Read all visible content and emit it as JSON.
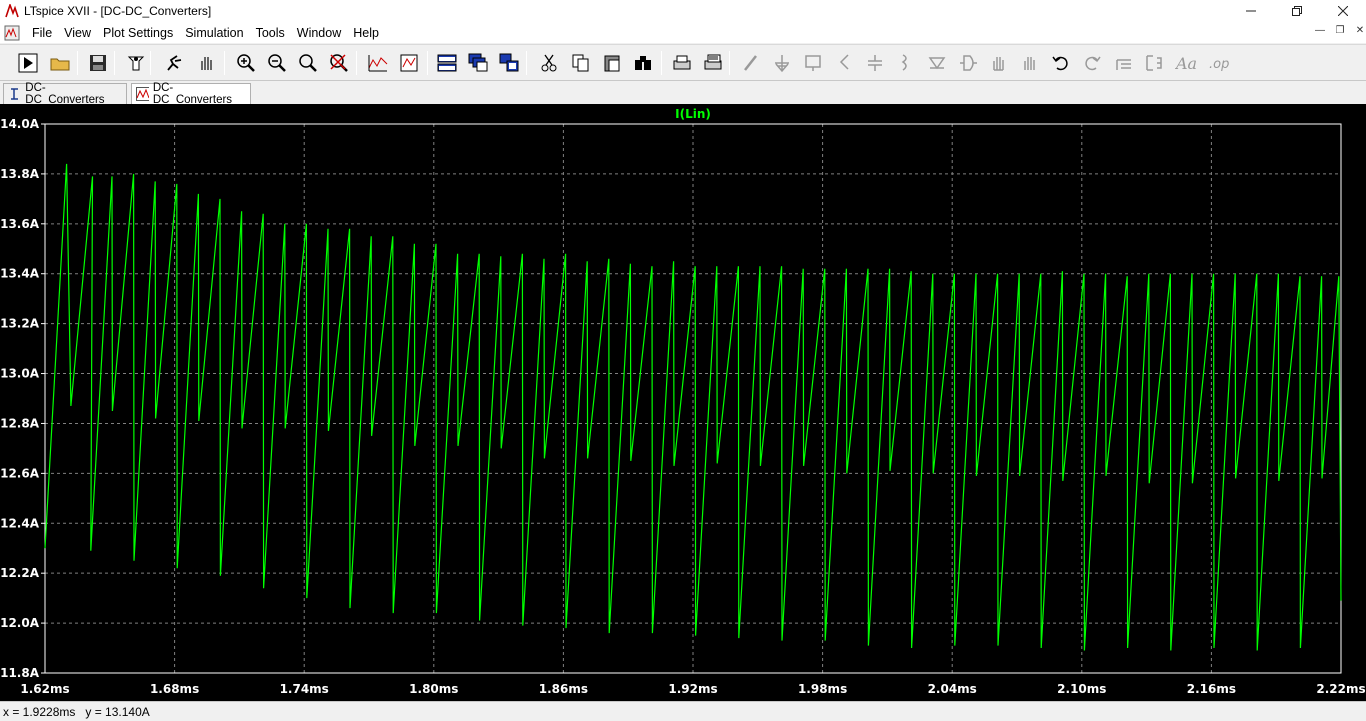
{
  "window": {
    "title": "LTspice XVII - [DC-DC_Converters]"
  },
  "menu": [
    "File",
    "View",
    "Plot Settings",
    "Simulation",
    "Tools",
    "Window",
    "Help"
  ],
  "toolbar_icons": [
    "run-icon",
    "open-icon",
    "save-icon",
    "control-panel-icon",
    "halt-icon",
    "pan-icon",
    "zoom-in-icon",
    "zoom-out-icon",
    "zoom-box-icon",
    "zoom-cancel-icon",
    "autorange-icon",
    "plot-settings-icon",
    "tile-horizontal-icon",
    "cascade-icon",
    "tile-vertical-icon",
    "cut-icon",
    "copy-icon",
    "paste-icon",
    "find-icon",
    "print-icon",
    "print-preview-icon",
    "wire-icon",
    "ground-icon",
    "label-icon",
    "resistor-icon",
    "capacitor-icon",
    "inductor-icon",
    "diode-icon",
    "component-icon",
    "move-icon",
    "drag-icon",
    "undo-icon",
    "redo-icon",
    "rotate-icon",
    "mirror-icon",
    "text-icon",
    "spice-directive-icon"
  ],
  "tabs": [
    {
      "label": "DC-DC_Converters",
      "kind": "schematic"
    },
    {
      "label": "DC-DC_Converters",
      "kind": "waveform"
    }
  ],
  "colors": {
    "trace": "#00ff00",
    "axis_text": "#ffffff",
    "grid": "#808080",
    "plot_bg": "#000000",
    "title": "#00ff00"
  },
  "chart_data": {
    "type": "line",
    "title": "I(Lin)",
    "xlabel": "",
    "ylabel": "",
    "x_unit": "ms",
    "y_unit": "A",
    "xlim": [
      1.62,
      2.22
    ],
    "ylim": [
      11.8,
      14.0
    ],
    "x_ticks": [
      "1.62ms",
      "1.68ms",
      "1.74ms",
      "1.80ms",
      "1.86ms",
      "1.92ms",
      "1.98ms",
      "2.04ms",
      "2.10ms",
      "2.16ms",
      "2.22ms"
    ],
    "y_ticks": [
      "14.0A",
      "13.8A",
      "13.6A",
      "13.4A",
      "13.2A",
      "13.0A",
      "12.8A",
      "12.6A",
      "12.4A",
      "12.2A",
      "12.0A",
      "11.8A"
    ],
    "grid": true,
    "series": [
      {
        "name": "I(Lin)",
        "x": [
          1.62,
          1.63,
          1.632,
          1.642,
          1.6412,
          1.651,
          1.6512,
          1.661,
          1.6612,
          1.671,
          1.6712,
          1.681,
          1.6812,
          1.691,
          1.6912,
          1.701,
          1.7012,
          1.711,
          1.7112,
          1.721,
          1.7212,
          1.731,
          1.7312,
          1.741,
          1.7412,
          1.751,
          1.7512,
          1.761,
          1.7612,
          1.771,
          1.7712,
          1.781,
          1.7812,
          1.791,
          1.7912,
          1.801,
          1.8012,
          1.811,
          1.8112,
          1.821,
          1.8212,
          1.831,
          1.8312,
          1.841,
          1.8412,
          1.851,
          1.8512,
          1.861,
          1.8612,
          1.871,
          1.8712,
          1.881,
          1.8812,
          1.891,
          1.8912,
          1.901,
          1.9012,
          1.911,
          1.9112,
          1.921,
          1.9212,
          1.931,
          1.9312,
          1.941,
          1.9412,
          1.951,
          1.9512,
          1.961,
          1.9612,
          1.971,
          1.9712,
          1.981,
          1.9812,
          1.991,
          1.9912,
          2.001,
          2.0012,
          2.011,
          2.0112,
          2.021,
          2.0212,
          2.031,
          2.0312,
          2.041,
          2.0412,
          2.051,
          2.0512,
          2.061,
          2.0612,
          2.071,
          2.0712,
          2.081,
          2.0812,
          2.091,
          2.0912,
          2.101,
          2.1012,
          2.111,
          2.1112,
          2.121,
          2.1212,
          2.131,
          2.1312,
          2.141,
          2.1412,
          2.151,
          2.1512,
          2.161,
          2.1612,
          2.171,
          2.1712,
          2.181,
          2.1812,
          2.191,
          2.1912,
          2.201,
          2.2012,
          2.211,
          2.2112,
          2.219,
          2.22
        ],
        "y": [
          12.3,
          13.84,
          12.87,
          13.79,
          12.29,
          13.79,
          12.85,
          13.8,
          12.25,
          13.77,
          12.82,
          13.76,
          12.22,
          13.72,
          12.81,
          13.7,
          12.19,
          13.65,
          12.78,
          13.64,
          12.14,
          13.6,
          12.78,
          13.6,
          12.1,
          13.58,
          12.77,
          13.58,
          12.06,
          13.55,
          12.75,
          13.55,
          12.04,
          13.52,
          12.71,
          13.52,
          12.04,
          13.48,
          12.71,
          13.48,
          12.01,
          13.47,
          12.7,
          13.48,
          11.99,
          13.46,
          12.66,
          13.48,
          11.98,
          13.45,
          12.66,
          13.46,
          11.96,
          13.44,
          12.65,
          13.43,
          11.96,
          13.45,
          12.63,
          13.43,
          11.95,
          13.43,
          12.64,
          13.43,
          11.94,
          13.43,
          12.63,
          13.43,
          11.93,
          13.42,
          12.63,
          13.42,
          11.93,
          13.42,
          12.6,
          13.42,
          11.91,
          13.42,
          12.61,
          13.41,
          11.9,
          13.4,
          12.6,
          13.4,
          11.91,
          13.4,
          12.59,
          13.4,
          11.91,
          13.4,
          12.59,
          13.4,
          11.9,
          13.41,
          12.57,
          13.4,
          11.89,
          13.4,
          12.59,
          13.39,
          11.9,
          13.4,
          12.56,
          13.4,
          11.89,
          13.4,
          12.56,
          13.4,
          11.9,
          13.4,
          12.58,
          13.4,
          11.89,
          13.4,
          12.57,
          13.39,
          11.9,
          13.39,
          12.58,
          13.39,
          12.09
        ]
      }
    ]
  },
  "status": {
    "x": "x = 1.9228ms",
    "y": "y = 13.140A"
  }
}
